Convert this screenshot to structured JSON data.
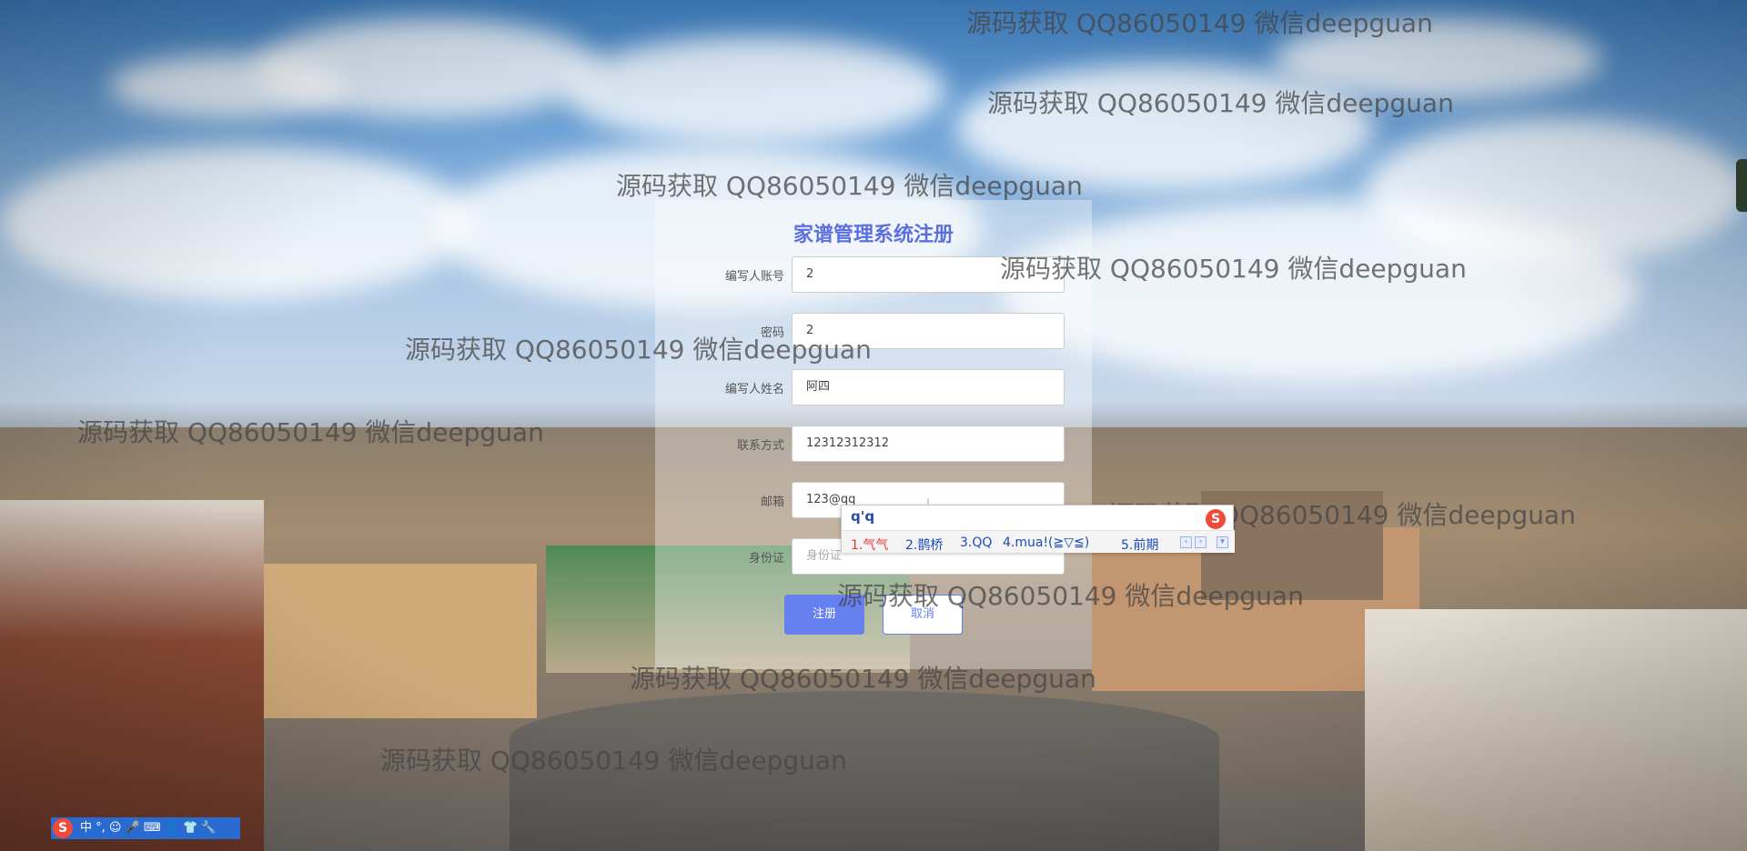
{
  "form": {
    "title": "家谱管理系统注册",
    "fields": [
      {
        "label": "编写人账号",
        "value": "2",
        "placeholder": ""
      },
      {
        "label": "密码",
        "value": "2",
        "placeholder": ""
      },
      {
        "label": "编写人姓名",
        "value": "阿四",
        "placeholder": ""
      },
      {
        "label": "联系方式",
        "value": "12312312312",
        "placeholder": ""
      },
      {
        "label": "邮箱",
        "value": "123@qq",
        "placeholder": ""
      },
      {
        "label": "身份证",
        "value": "",
        "placeholder": "身份证"
      }
    ],
    "register_label": "注册",
    "cancel_label": "取消"
  },
  "ime_popup": {
    "composition": "q'q",
    "candidates": [
      "1.气气",
      "2.鹊桥",
      "3.QQ",
      "4.mua!(≧▽≦)",
      "5.前期"
    ],
    "logo": "S"
  },
  "watermark": {
    "text": "源码获取 QQ86050149 微信deepguan"
  },
  "ime_toolbar": {
    "logo": "S",
    "items": "中 °, ☺ 🎤 ⌨ 👤 👕 🔧"
  },
  "colors": {
    "accent": "#6680f0",
    "title": "#5b6fe0"
  }
}
